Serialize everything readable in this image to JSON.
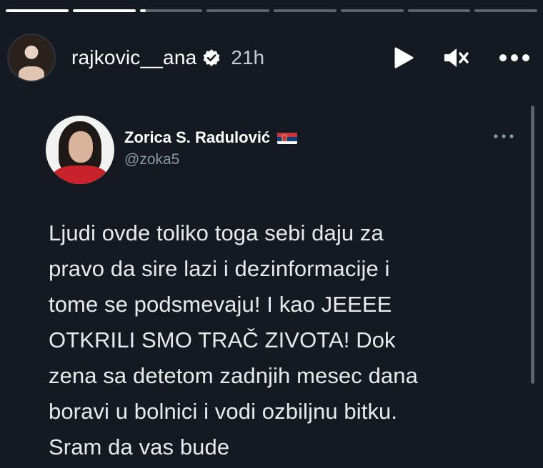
{
  "story": {
    "progress": [
      1,
      1,
      0.1,
      0,
      0,
      0,
      0,
      0
    ],
    "user": {
      "username": "rajkovic__ana",
      "verified": true,
      "time_ago": "21h"
    },
    "actions": {
      "play_icon": "play-icon",
      "mute_icon": "muted-speaker-icon",
      "more_icon": "more-horizontal-icon"
    }
  },
  "tweet": {
    "display_name": "Zorica S. Radulović",
    "flag_icon": "serbia-flag-icon",
    "handle": "@zoka5",
    "lines": [
      "Ljudi ovde toliko toga sebi daju za",
      "pravo da sire lazi i dezinformacije i",
      "tome se podsmevaju! I kao JEEEE",
      "OTKRILI SMO TRAČ ZIVOTA! Dok",
      "zena sa detetom zadnjih mesec dana",
      "boravi u bolnici i vodi ozbiljnu bitku.",
      "Sram da vas bude"
    ]
  },
  "colors": {
    "background": "#151a22",
    "text": "#e8eaed",
    "handle": "#8b97a3",
    "progress_active": "#ffffff",
    "progress_inactive": "rgba(255,255,255,0.32)"
  }
}
